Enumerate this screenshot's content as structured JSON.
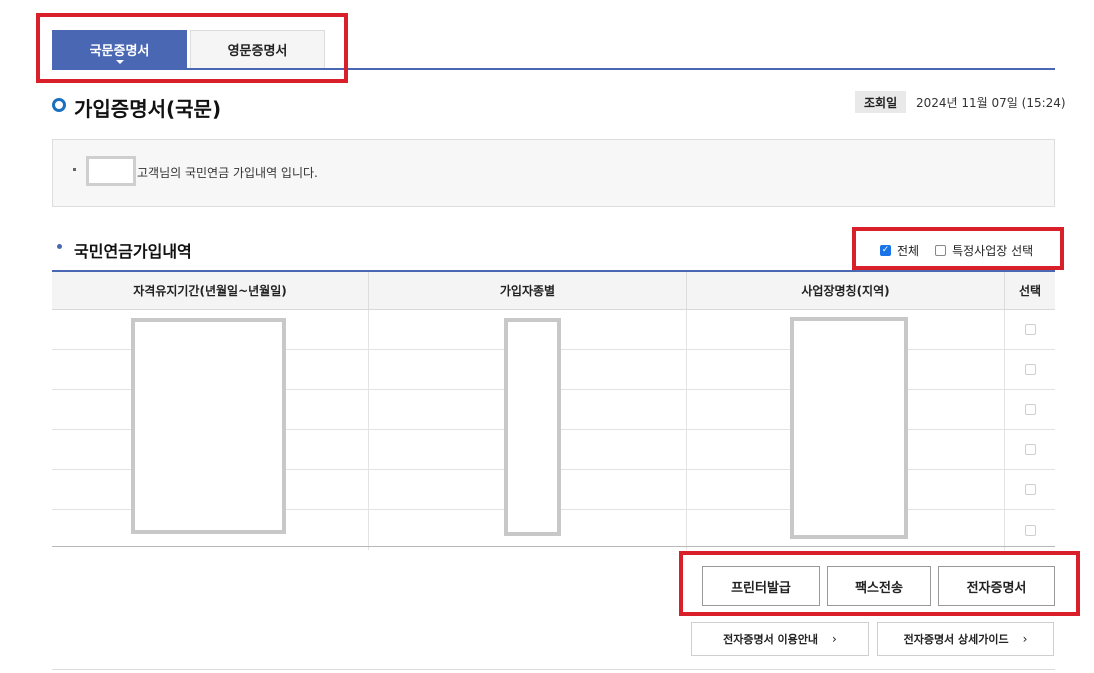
{
  "tabs": [
    {
      "label": "국문증명서",
      "active": true
    },
    {
      "label": "영문증명서",
      "active": false
    }
  ],
  "page": {
    "title": "가입증명서(국문)",
    "date_label": "조회일",
    "date_value": "2024년 11월 07일 (15:24)"
  },
  "info": {
    "text": "고객님의 국민연금 가입내역 입니다."
  },
  "section": {
    "title": "국민연금가입내역",
    "filter_all": "전체",
    "filter_all_checked": true,
    "filter_specific": "특정사업장 선택",
    "filter_specific_checked": false
  },
  "table": {
    "headers": [
      "자격유지기간(년월일~년월일)",
      "가입자종별",
      "사업장명칭(지역)",
      "선택"
    ],
    "row_count": 6
  },
  "actions": {
    "print": "프린터발급",
    "fax": "팩스전송",
    "ecert": "전자증명서"
  },
  "guides": {
    "usage": "전자증명서 이용안내",
    "detail": "전자증명서 상세가이드"
  },
  "colors": {
    "accent": "#4a67b3",
    "highlight": "#d9202a"
  }
}
